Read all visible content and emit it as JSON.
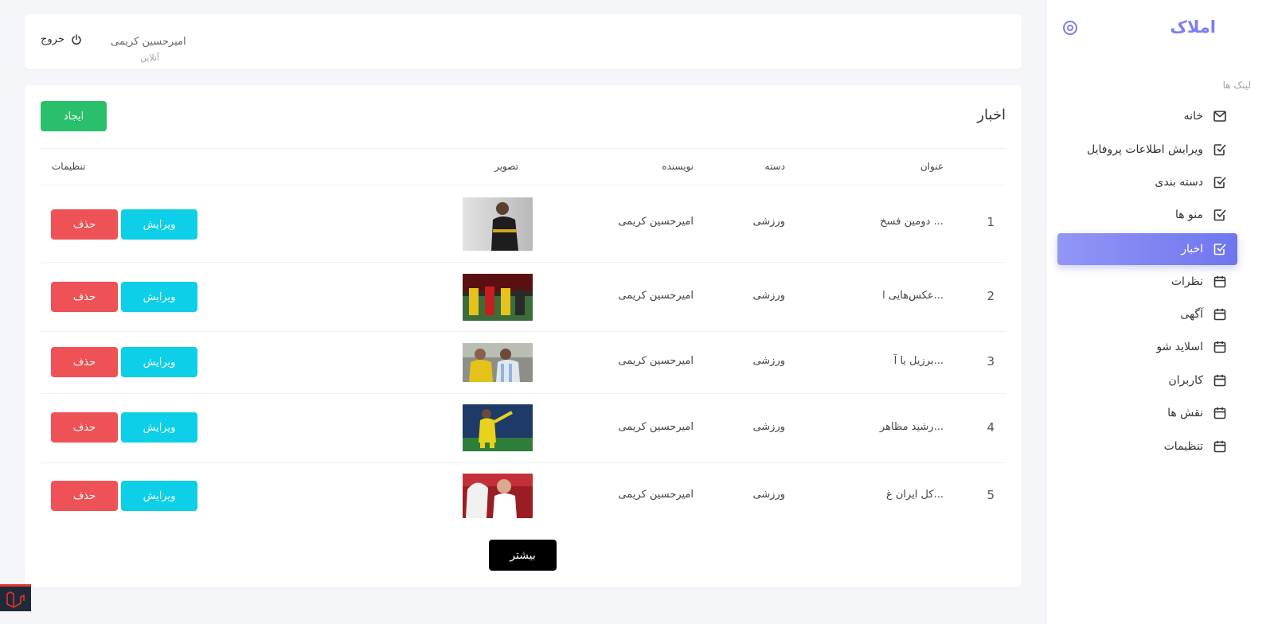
{
  "sidebar": {
    "brand": "املاک",
    "links_heading": "لینک ها",
    "items": [
      {
        "label": "خانه",
        "icon": "envelope-icon",
        "active": false
      },
      {
        "label": "ویرایش اطلاعات پروفایل",
        "icon": "checkbox-icon",
        "active": false
      },
      {
        "label": "دسته بندی",
        "icon": "checkbox-icon",
        "active": false
      },
      {
        "label": "منو ها",
        "icon": "checkbox-icon",
        "active": false
      },
      {
        "label": "اخبار",
        "icon": "checkbox-icon",
        "active": true
      },
      {
        "label": "نظرات",
        "icon": "calendar-icon",
        "active": false
      },
      {
        "label": "آگهی",
        "icon": "calendar-icon",
        "active": false
      },
      {
        "label": "اسلاید شو",
        "icon": "calendar-icon",
        "active": false
      },
      {
        "label": "کاربران",
        "icon": "calendar-icon",
        "active": false
      },
      {
        "label": "نقش ها",
        "icon": "calendar-icon",
        "active": false
      },
      {
        "label": "تنظیمات",
        "icon": "calendar-icon",
        "active": false
      }
    ]
  },
  "topbar": {
    "logout_label": "خروج",
    "user_name": "امیرحسین کریمی",
    "user_status": "آنلاین"
  },
  "panel": {
    "title": "اخبار",
    "create_label": "ایجاد",
    "more_label": "بیشتر",
    "columns": {
      "title": "عنوان",
      "category": "دسته",
      "author": "نویسنده",
      "image": "تصویر",
      "settings": "تنظیمات"
    },
    "edit_label": "ویرایش",
    "delete_label": "حذف",
    "rows": [
      {
        "num": "1",
        "title": "دومین فسخ ...",
        "category": "ورزشی",
        "author": "امیرحسین کریمی"
      },
      {
        "num": "2",
        "title": "عکس‌هایی ا...",
        "category": "ورزشی",
        "author": "امیرحسین کریمی"
      },
      {
        "num": "3",
        "title": "برزیل یا آ...",
        "category": "ورزشی",
        "author": "امیرحسین کریمی"
      },
      {
        "num": "4",
        "title": "رشید مظاهر...",
        "category": "ورزشی",
        "author": "امیرحسین کریمی"
      },
      {
        "num": "5",
        "title": "کل ایران غ...",
        "category": "ورزشی",
        "author": "امیرحسین کریمی"
      }
    ]
  },
  "colors": {
    "accent": "#7b7ff2",
    "create": "#2ac06b",
    "edit": "#0ecfe8",
    "delete": "#ee5256"
  }
}
